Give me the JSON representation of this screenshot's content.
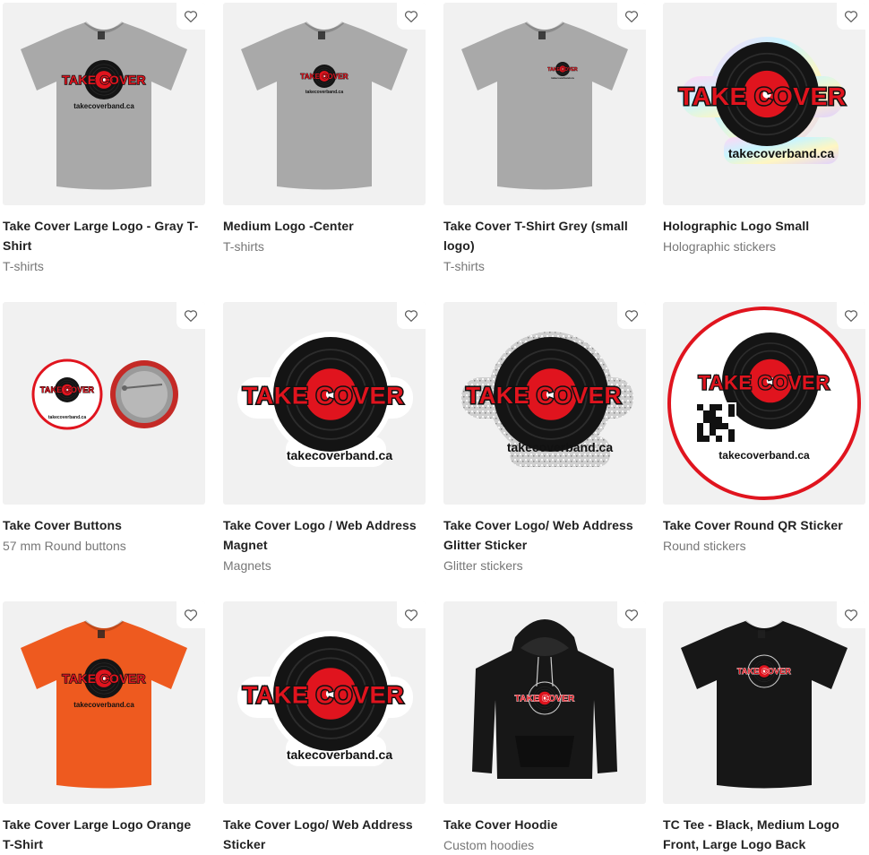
{
  "products": [
    {
      "title": "Take Cover Large Logo - Gray T-Shirt",
      "category": "T-shirts",
      "image": "gray-tshirt-large-logo",
      "liked": false
    },
    {
      "title": "Medium Logo -Center",
      "category": "T-shirts",
      "image": "gray-tshirt-medium-logo",
      "liked": false
    },
    {
      "title": "Take Cover T-Shirt Grey (small logo)",
      "category": "T-shirts",
      "image": "gray-tshirt-small-logo",
      "liked": false
    },
    {
      "title": "Holographic Logo Small",
      "category": "Holographic stickers",
      "image": "holographic-sticker",
      "liked": false
    },
    {
      "title": "Take Cover Buttons",
      "category": "57 mm Round buttons",
      "image": "round-buttons",
      "liked": false
    },
    {
      "title": "Take Cover Logo / Web Address Magnet",
      "category": "Magnets",
      "image": "logo-magnet",
      "liked": false
    },
    {
      "title": "Take Cover Logo/ Web Address Glitter Sticker",
      "category": "Glitter stickers",
      "image": "glitter-sticker",
      "liked": false
    },
    {
      "title": "Take Cover Round QR Sticker",
      "category": "Round stickers",
      "image": "round-qr-sticker",
      "liked": false
    },
    {
      "title": "Take Cover Large Logo Orange T-Shirt",
      "category": "",
      "image": "orange-tshirt",
      "liked": false
    },
    {
      "title": "Take Cover Logo/ Web Address Sticker",
      "category": "",
      "image": "logo-sticker",
      "liked": false
    },
    {
      "title": "Take Cover Hoodie",
      "category": "Custom hoodies",
      "image": "black-hoodie",
      "liked": false
    },
    {
      "title": "TC Tee - Black, Medium Logo Front, Large Logo Back",
      "category": "",
      "image": "black-tshirt",
      "liked": false
    }
  ],
  "artwork": {
    "logo_text": "TAKE COVER",
    "web_address": "takecoverband.ca"
  },
  "colors": {
    "logo_red": "#e0141e",
    "record_black": "#141414",
    "tee_gray": "#a9a9a9",
    "tee_orange": "#ee5a1f",
    "garment_black": "#171717",
    "heart_outline": "#555555"
  }
}
